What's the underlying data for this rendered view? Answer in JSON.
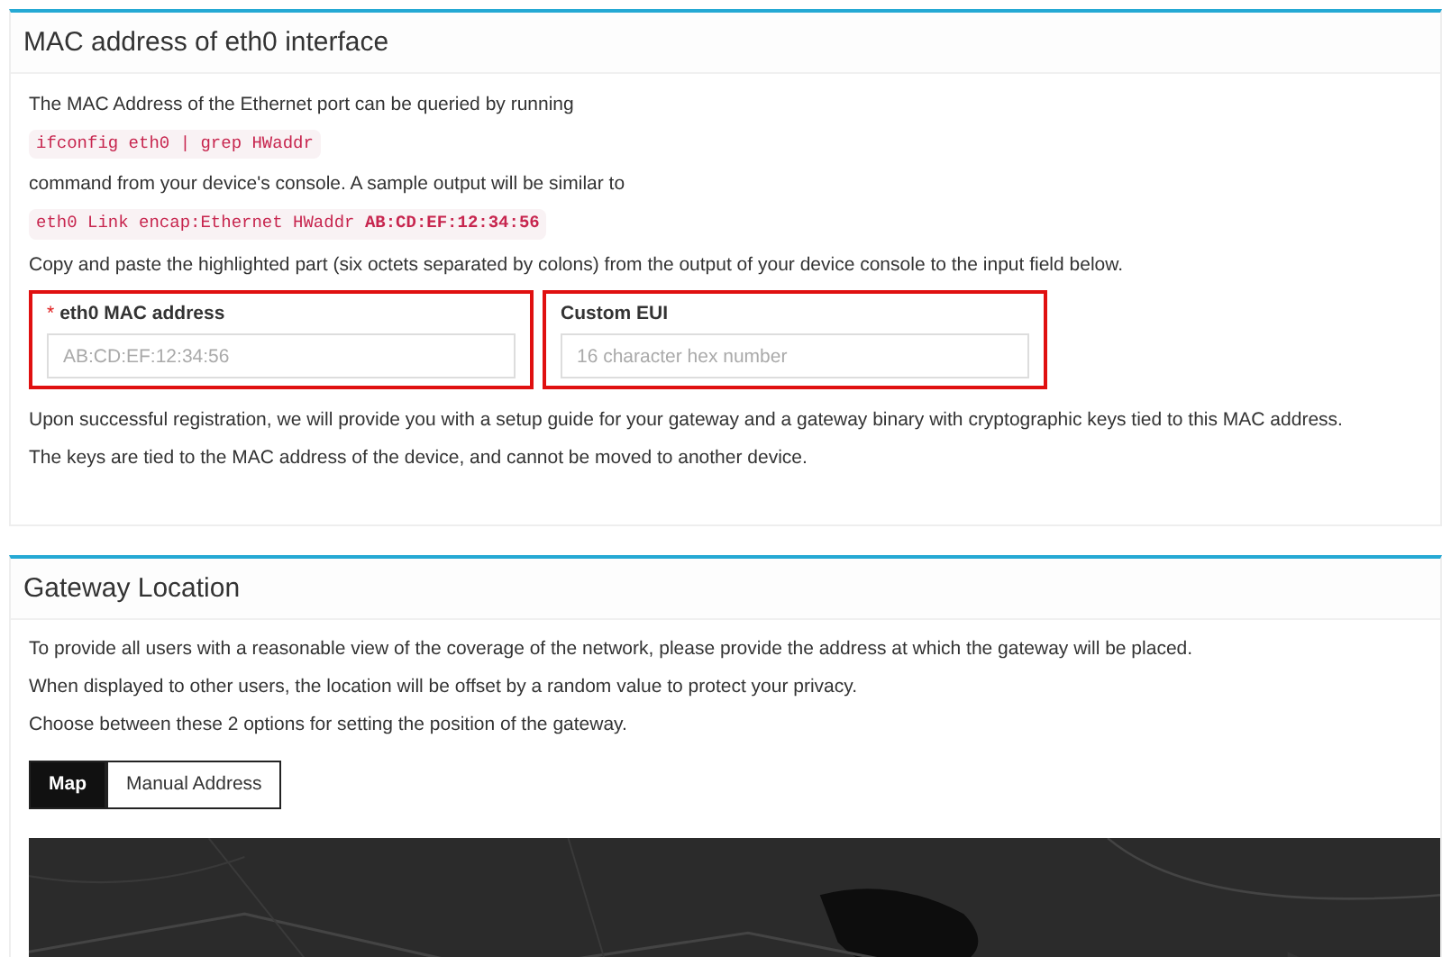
{
  "mac_section": {
    "title": "MAC address of eth0 interface",
    "intro": "The MAC Address of the Ethernet port can be queried by running",
    "command": "ifconfig eth0 | grep HWaddr",
    "after_command": "command from your device's console. A sample output will be similar to",
    "sample_output": "eth0 Link encap:Ethernet HWaddr **AB:CD:EF:12:34:56**",
    "instruction": "Copy and paste the highlighted part (six octets separated by colons) from the output of your device console to the input field below.",
    "fields": [
      {
        "label": "eth0 MAC address",
        "required": true,
        "required_mark": "*",
        "placeholder": "AB:CD:EF:12:34:56",
        "highlighted": true
      },
      {
        "label": "Custom EUI",
        "required": false,
        "placeholder": "16 character hex number",
        "highlighted": true
      }
    ],
    "notes": [
      "Upon successful registration, we will provide you with a setup guide for your gateway and a gateway binary with cryptographic keys tied to this MAC address.",
      "The keys are tied to the MAC address of the device, and cannot be moved to another device."
    ]
  },
  "location_section": {
    "title": "Gateway Location",
    "paragraphs": [
      "To provide all users with a reasonable view of the coverage of the network, please provide the address at which the gateway will be placed.",
      "When displayed to other users, the location will be offset by a random value to protect your privacy.",
      "Choose between these 2 options for setting the position of the gateway."
    ],
    "options": [
      {
        "label": "Map",
        "selected": true
      },
      {
        "label": "Manual Address",
        "selected": false
      }
    ]
  }
}
